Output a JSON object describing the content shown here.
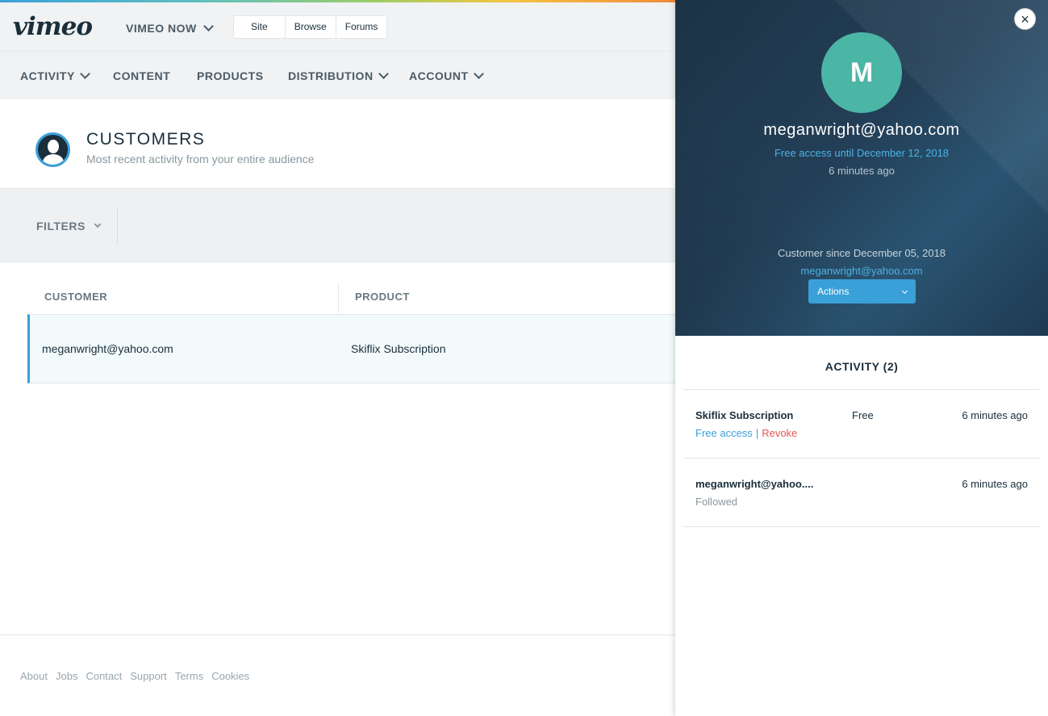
{
  "header": {
    "logo": "vimeo",
    "brand_dropdown": "VIMEO NOW",
    "segments": [
      "Site",
      "Browse",
      "Forums"
    ]
  },
  "nav": {
    "items": [
      {
        "label": "ACTIVITY",
        "dropdown": true
      },
      {
        "label": "CONTENT",
        "dropdown": false
      },
      {
        "label": "PRODUCTS",
        "dropdown": false
      },
      {
        "label": "DISTRIBUTION",
        "dropdown": true
      },
      {
        "label": "ACCOUNT",
        "dropdown": true
      }
    ]
  },
  "customers": {
    "title": "CUSTOMERS",
    "subtitle": "Most recent activity from your entire audience"
  },
  "filters": {
    "label": "FILTERS"
  },
  "table": {
    "columns": [
      "CUSTOMER",
      "PRODUCT"
    ],
    "rows": [
      {
        "customer": "meganwright@yahoo.com",
        "product": "Skiflix Subscription"
      }
    ]
  },
  "footer": {
    "links": [
      "About",
      "Jobs",
      "Contact",
      "Support",
      "Terms",
      "Cookies"
    ]
  },
  "panel": {
    "avatar_letter": "M",
    "email": "meganwright@yahoo.com",
    "access": "Free access until December 12, 2018",
    "time_ago": "6 minutes ago",
    "customer_since": "Customer since December 05, 2018",
    "email_link": "meganwright@yahoo.com",
    "actions_label": "Actions",
    "close_symbol": "×",
    "activity_title": "ACTIVITY (2)",
    "activity": [
      {
        "name": "Skiflix Subscription",
        "price": "Free",
        "time": "6 minutes ago",
        "link1": "Free access",
        "separator": "|",
        "link2": "Revoke"
      },
      {
        "name": "meganwright@yahoo....",
        "time": "6 minutes ago",
        "status": "Followed"
      }
    ]
  },
  "colors": {
    "accent": "#3aa0d8",
    "avatar_bg": "#4bb5a6",
    "danger": "#e5564e",
    "text_dark": "#1a2e3b"
  }
}
